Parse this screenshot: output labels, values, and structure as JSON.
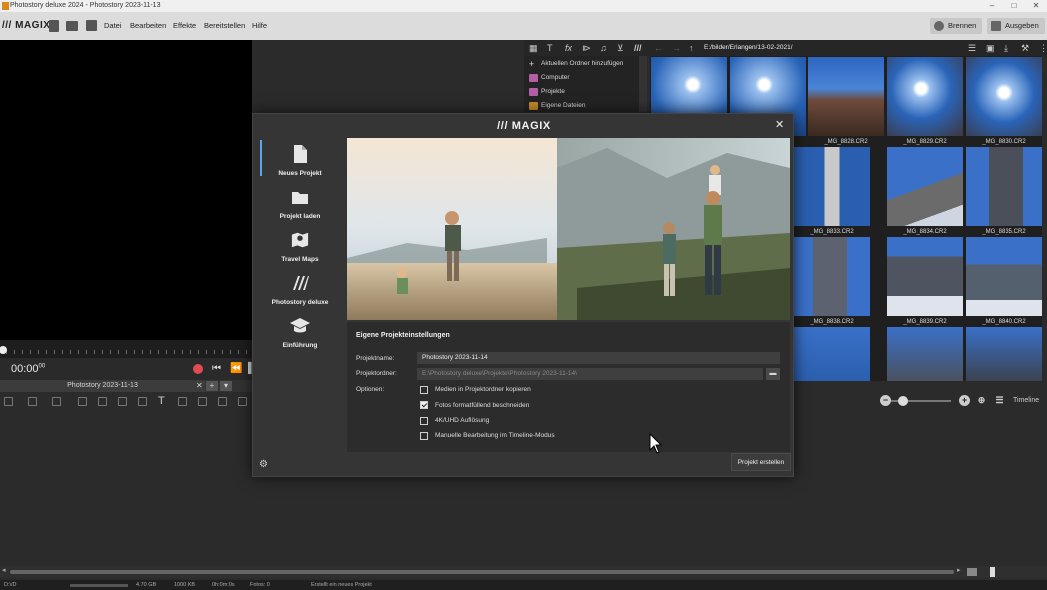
{
  "window": {
    "title": "Photostory deluxe 2024 - Photostory 2023-11-13",
    "controls": [
      "–",
      "□",
      "✕"
    ]
  },
  "menubar": {
    "logo": "/// MAGIX",
    "menus": [
      "Datei",
      "Bearbeiten",
      "Effekte",
      "Bereitstellen",
      "Hilfe"
    ],
    "burn_label": "Brennen",
    "export_label": "Ausgeben"
  },
  "preview": {
    "timecode": "00:00",
    "timecode_frames": "00"
  },
  "project_tab": {
    "label": "Photostory 2023-11-13",
    "close": "✕",
    "add": "+"
  },
  "browser": {
    "path": "E:/bilder/Erlangen/13-02-2021/",
    "tree": [
      {
        "label": "Aktuellen Ordner hinzufügen",
        "icon": "plus-icon"
      },
      {
        "label": "Computer",
        "icon": "computer-icon"
      },
      {
        "label": "Projekte",
        "icon": "projects-icon"
      },
      {
        "label": "Eigene Dateien",
        "icon": "folder-icon"
      }
    ],
    "thumbnails": [
      {
        "caption": ""
      },
      {
        "caption": ""
      },
      {
        "caption": "_MG_8828.CR2"
      },
      {
        "caption": "_MG_8829.CR2"
      },
      {
        "caption": "_MG_8830.CR2"
      },
      {
        "caption": "_MG_8833.CR2"
      },
      {
        "caption": "_MG_8834.CR2"
      },
      {
        "caption": "_MG_8835.CR2"
      },
      {
        "caption": "_MG_8838.CR2"
      },
      {
        "caption": "_MG_8839.CR2"
      },
      {
        "caption": "_MG_8840.CR2"
      }
    ],
    "timeline_label": "Timeline"
  },
  "dialog": {
    "logo": "/// MAGIX",
    "close": "✕",
    "nav": [
      {
        "label": "Neues Projekt",
        "icon": "new-file-icon"
      },
      {
        "label": "Projekt laden",
        "icon": "folder-icon"
      },
      {
        "label": "Travel Maps",
        "icon": "map-pin-icon"
      },
      {
        "label": "Photostory deluxe",
        "icon": "magix-logo-icon"
      },
      {
        "label": "Einführung",
        "icon": "graduation-cap-icon"
      }
    ],
    "section_title": "Eigene Projekteinstellungen",
    "project_name_label": "Projektname:",
    "project_name_value": "Photostory 2023-11-14",
    "project_folder_label": "Projektordner:",
    "project_folder_value": "E:\\Photostory deluxe\\Projekte\\Photostory 2023-11-14\\",
    "options_label": "Optionen:",
    "options": [
      {
        "label": "Medien in Projektordner kopieren",
        "checked": false
      },
      {
        "label": "Fotos formatfüllend beschneiden",
        "checked": true
      },
      {
        "label": "4K/UHD Auflösung",
        "checked": false
      },
      {
        "label": "Manuelle Bearbeitung im Timeline-Modus",
        "checked": false
      }
    ],
    "create_button": "Projekt erstellen"
  },
  "statusbar": {
    "drive": "D:\\/D",
    "disk": "4.70 GB",
    "size": "1000 KB",
    "duration": "0h:0m:0s",
    "photos": "Fotos: 0",
    "message": "Erstellt ein neues Projekt"
  },
  "colors": {
    "accent": "#5aa6e8",
    "record": "#e14b54",
    "dialog_bg": "#353535"
  }
}
